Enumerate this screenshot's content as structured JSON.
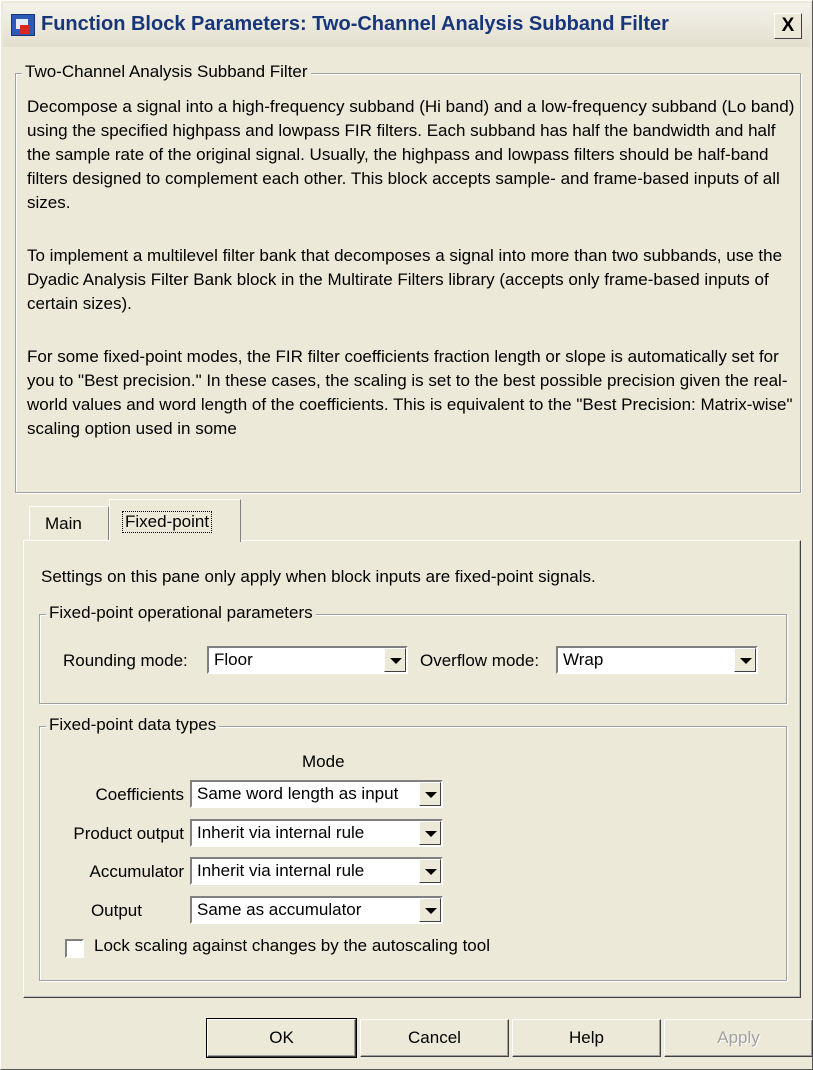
{
  "window": {
    "title": "Function Block Parameters: Two-Channel Analysis Subband Filter",
    "close_glyph": "X"
  },
  "description": {
    "group_title": "Two-Channel Analysis Subband Filter",
    "paragraphs": [
      "Decompose a signal into a high-frequency subband (Hi band) and a low-frequency subband (Lo band) using the specified highpass and lowpass FIR filters.  Each subband has half the bandwidth and half the sample rate of the original signal. Usually, the highpass and lowpass filters should be half-band filters designed to complement each other. This block accepts sample- and frame-based inputs of all sizes.",
      "To implement a multilevel filter bank that decomposes a signal into more than two subbands, use the Dyadic Analysis Filter Bank block in the Multirate Filters library (accepts only frame-based inputs of certain sizes).",
      "For some fixed-point modes, the FIR filter coefficients fraction length or slope is automatically set for you to \"Best precision.\" In these cases, the scaling is set to the best possible precision given the real-world values and word length of the coefficients. This is equivalent to the \"Best Precision: Matrix-wise\" scaling option used in some"
    ]
  },
  "tabs": [
    {
      "label": "Main",
      "active": false
    },
    {
      "label": "Fixed-point",
      "active": true
    }
  ],
  "fixed_point": {
    "info": "Settings on this pane only apply when block inputs are fixed-point signals.",
    "operational": {
      "group_title": "Fixed-point operational parameters",
      "rounding_label": "Rounding mode:",
      "rounding_value": "Floor",
      "overflow_label": "Overflow mode:",
      "overflow_value": "Wrap"
    },
    "data_types": {
      "group_title": "Fixed-point data types",
      "mode_header": "Mode",
      "rows": [
        {
          "label": "Coefficients",
          "value": "Same word length as input"
        },
        {
          "label": "Product output",
          "value": "Inherit via internal rule"
        },
        {
          "label": "Accumulator",
          "value": "Inherit via internal rule"
        },
        {
          "label": "Output",
          "value": "Same as accumulator"
        }
      ],
      "lock_label": "Lock scaling against changes by the autoscaling tool",
      "lock_checked": false
    }
  },
  "buttons": {
    "ok": "OK",
    "cancel": "Cancel",
    "help": "Help",
    "apply": "Apply"
  },
  "colors": {
    "dialog_background": "#ece9d8",
    "title_text": "#17367a",
    "disabled_text": "#a0a0a0"
  }
}
